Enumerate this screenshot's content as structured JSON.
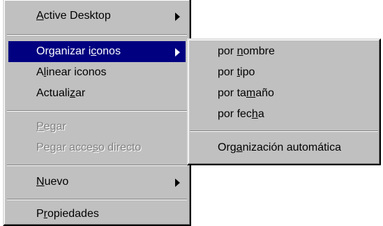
{
  "context_menu": {
    "items": [
      {
        "pre": "",
        "key": "A",
        "post": "ctive Desktop",
        "submenu": true
      },
      {
        "pre": "Organizar i",
        "key": "c",
        "post": "onos",
        "submenu": true,
        "highlighted": true
      },
      {
        "pre": "A",
        "key": "l",
        "post": "inear iconos"
      },
      {
        "pre": "Actuali",
        "key": "z",
        "post": "ar"
      },
      {
        "pre": "",
        "key": "P",
        "post": "egar",
        "disabled": true
      },
      {
        "pre": "Pegar acce",
        "key": "s",
        "post": "o directo",
        "disabled": true
      },
      {
        "pre": "",
        "key": "N",
        "post": "uevo",
        "submenu": true
      },
      {
        "pre": "P",
        "key": "r",
        "post": "opiedades"
      }
    ]
  },
  "submenu_organizar": {
    "items": [
      {
        "pre": "por ",
        "key": "n",
        "post": "ombre"
      },
      {
        "pre": "por ",
        "key": "t",
        "post": "ipo"
      },
      {
        "pre": "por ta",
        "key": "m",
        "post": "año"
      },
      {
        "pre": "por fec",
        "key": "h",
        "post": "a"
      },
      {
        "pre": "Org",
        "key": "a",
        "post": "nización automática"
      }
    ]
  },
  "colors": {
    "menu_face": "#c0c0c0",
    "highlight": "#000080",
    "disabled_text": "#808080"
  },
  "icons": [
    "submenu-arrow-icon"
  ]
}
